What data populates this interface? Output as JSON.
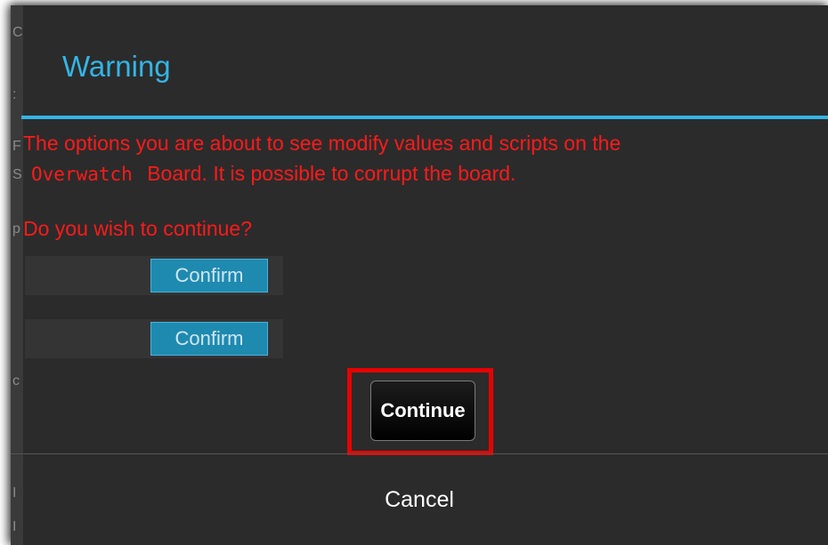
{
  "dialog": {
    "title": "Warning",
    "message_line1": "The options you are about to see modify values and scripts on the",
    "board_name": "Overwatch",
    "message_line2": "Board.  It is possible to corrupt the board.",
    "question": "Do you wish to continue?",
    "confirm_label_1": "Confirm",
    "confirm_label_2": "Confirm",
    "continue_label": "Continue",
    "cancel_label": "Cancel"
  },
  "colors": {
    "title": "#33b5e5",
    "warning_text": "#ff1a1a",
    "highlight": "#e50000",
    "confirm_button": "#1e8ab0"
  }
}
